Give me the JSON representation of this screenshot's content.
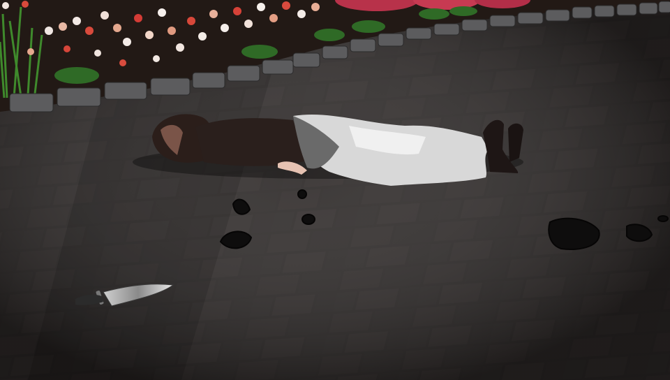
{
  "scene": {
    "colors": {
      "pavement": "#2a2625",
      "pavement_light": "#3a3533",
      "grout": "#1a1716",
      "soil": "#241a16",
      "curb_stone": "#5e5e60",
      "blood": "#0d0c0c"
    },
    "icons": {
      "body": "fallen-body-icon",
      "knife": "knife-icon",
      "flowers": "flower-bed-icon",
      "stains": "blood-stain-icon"
    }
  }
}
